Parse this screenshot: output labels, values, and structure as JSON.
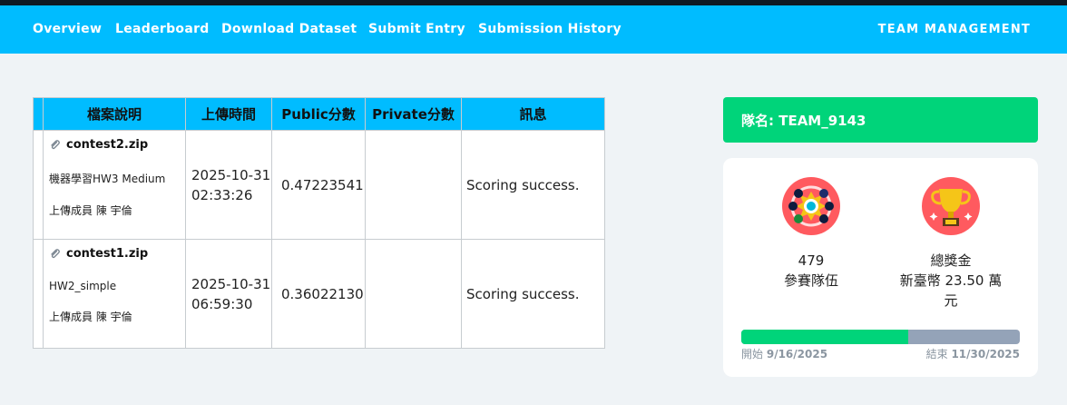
{
  "nav": {
    "items": [
      "Overview",
      "Leaderboard",
      "Download Dataset",
      "Submit Entry",
      "Submission History"
    ],
    "team_management": "TEAM MANAGEMENT"
  },
  "table": {
    "headers": [
      "檔案說明",
      "上傳時間",
      "Public分數",
      "Private分數",
      "訊息"
    ],
    "rows": [
      {
        "file": "contest2.zip",
        "description": "機器學習HW3 Medium",
        "uploader": "上傳成員 陳 宇倫",
        "date": "2025-10-31",
        "time": "02:33:26",
        "public_score": "0.47223541",
        "private_score": "",
        "message": "Scoring success."
      },
      {
        "file": "contest1.zip",
        "description": "HW2_simple",
        "uploader": "上傳成員 陳 宇倫",
        "date": "2025-10-31",
        "time": "06:59:30",
        "public_score": "0.36022130",
        "private_score": "",
        "message": "Scoring success."
      }
    ]
  },
  "team": {
    "label": "隊名: TEAM_9143"
  },
  "stats": {
    "teams_count": "479",
    "teams_label": "參賽隊伍",
    "prize_label": "總獎金",
    "prize_value_line1": "新臺幣 23.50 萬",
    "prize_value_line2": "元",
    "progress_fraction": 0.6,
    "start_label": "開始",
    "start_date": "9/16/2025",
    "end_label": "結束",
    "end_date": "11/30/2025"
  },
  "icons": {
    "attachment": "paperclip-icon",
    "teams": "team-circle-icon",
    "prize": "trophy-icon"
  },
  "colors": {
    "nav_bg": "#00bcff",
    "team_bar": "#00d47a",
    "progress_fill": "#00d47a",
    "progress_track": "#94a3b8",
    "icon_circle": "#ff5a5f"
  }
}
